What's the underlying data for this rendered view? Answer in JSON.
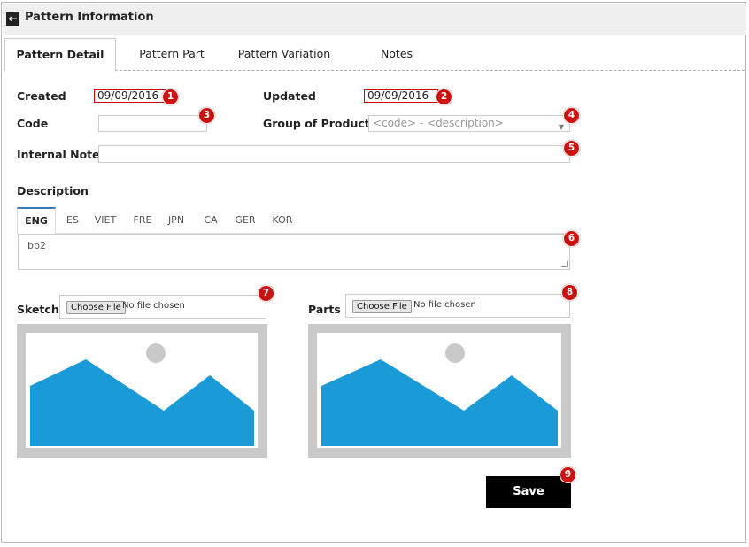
{
  "header": {
    "title": "Pattern Information"
  },
  "tabs": [
    {
      "label": "Pattern Detail"
    },
    {
      "label": "Pattern Part"
    },
    {
      "label": "Pattern Variation"
    },
    {
      "label": "Notes"
    }
  ],
  "form": {
    "created_label": "Created",
    "created_value": "09/09/2016",
    "updated_label": "Updated",
    "updated_value": "09/09/2016",
    "code_label": "Code",
    "code_value": "",
    "group_label": "Group of Product",
    "group_placeholder": "<code> - <description>",
    "internal_note_label": "Internal Note",
    "internal_note_value": "",
    "description_label": "Description",
    "description_value": "bb2",
    "sketch_label": "Sketch",
    "parts_label": "Parts",
    "choose_file": "Choose File",
    "no_file": "No file chosen",
    "save_label": "Save"
  },
  "languages": [
    "ENG",
    "ES",
    "VIET",
    "FRE",
    "JPN",
    "CA",
    "GER",
    "KOR"
  ],
  "badges": [
    "1",
    "2",
    "3",
    "4",
    "5",
    "6",
    "7",
    "8",
    "9"
  ],
  "colors": {
    "image_blue": "#1a9ad6",
    "badge_red": "#cc1111"
  }
}
